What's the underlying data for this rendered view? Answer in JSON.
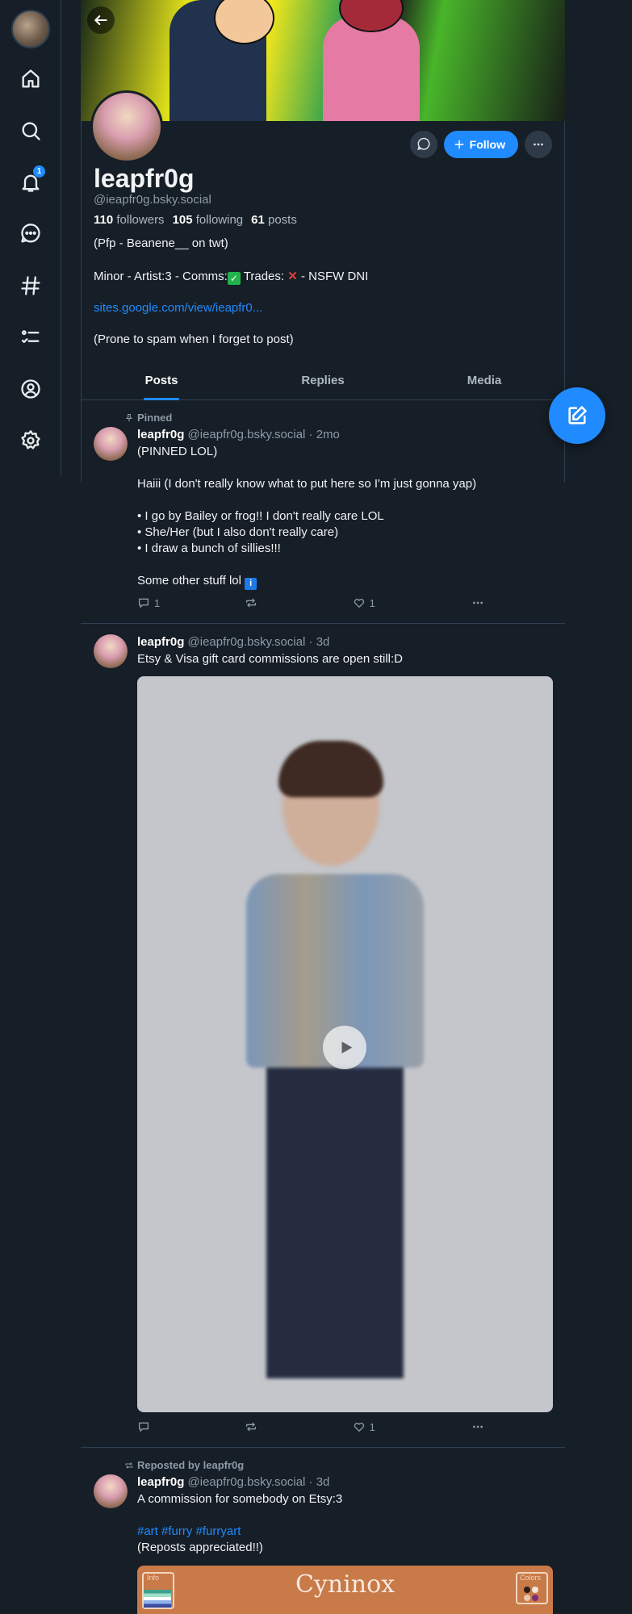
{
  "nav": {
    "notifications_badge": "1",
    "items": [
      "home-icon",
      "search-icon",
      "bell-icon",
      "chat-icon",
      "hashtag-icon",
      "lists-icon",
      "profile-icon",
      "settings-icon"
    ]
  },
  "profile": {
    "display_name": "leapfr0g",
    "handle": "@ieapfr0g.bsky.social",
    "followers_count": "110",
    "followers_label": "followers",
    "following_count": "105",
    "following_label": "following",
    "posts_count": "61",
    "posts_label": "posts",
    "follow_label": "Follow",
    "bio": {
      "line1": "(Pfp - Beanene__ on twt)",
      "line2_a": "Minor - Artist:3 - Comms:",
      "line2_check": "✓",
      "line2_b": " Trades: ",
      "line2_cross": "✕",
      "line2_c": " - NSFW DNI",
      "link": "sites.google.com/view/ieapfr0...",
      "line4": "(Prone to spam when I forget to post)"
    }
  },
  "tabs": [
    "Posts",
    "Replies",
    "Media"
  ],
  "posts": [
    {
      "meta": "Pinned",
      "name": "leapfr0g",
      "handle_time": "@ieapfr0g.bsky.social · 2mo",
      "lines": [
        "(PINNED LOL)",
        "Haiii (I don't really know what to put here so I'm just gonna yap)",
        " • I go by Bailey or frog!! I don't really care LOL",
        "• She/Her (but I also don't really care)",
        "• I draw a bunch of sillies!!!",
        "Some other stuff lol "
      ],
      "info_emoji": "i",
      "replies": "1",
      "reposts": "",
      "likes": "1"
    },
    {
      "meta": "",
      "name": "leapfr0g",
      "handle_time": "@ieapfr0g.bsky.social · 3d",
      "lines": [
        "Etsy & Visa gift card commissions are open still:D"
      ],
      "replies": "",
      "reposts": "",
      "likes": "1"
    },
    {
      "meta": "Reposted by leapfr0g",
      "name": "leapfr0g",
      "handle_time": "@ieapfr0g.bsky.social · 3d",
      "lines": [
        "A commission for somebody on Etsy:3",
        "#art #furry #furryart",
        "(Reposts appreciated!!)"
      ],
      "embed_title": "Cyninox",
      "embed_info": "Info",
      "embed_colors": "Colors"
    }
  ]
}
